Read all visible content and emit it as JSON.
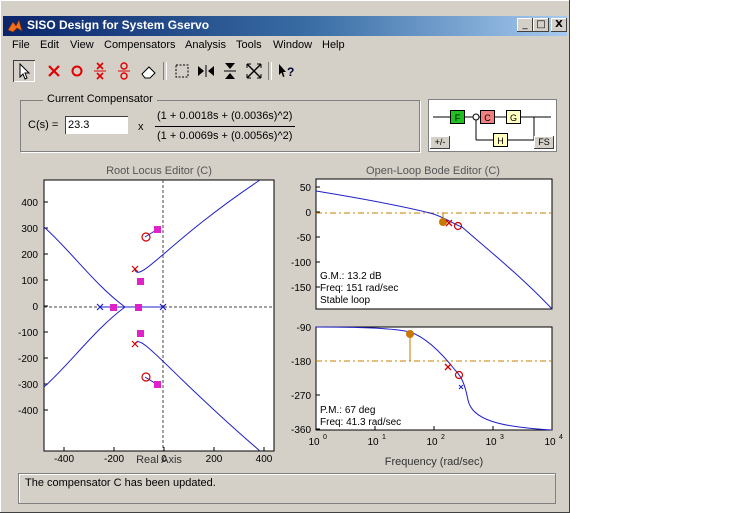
{
  "window": {
    "title": "SISO Design for System Gservo",
    "controls": {
      "minimize": "_",
      "maximize": "□",
      "close": "X"
    }
  },
  "menu": [
    "File",
    "Edit",
    "View",
    "Compensators",
    "Analysis",
    "Tools",
    "Window",
    "Help"
  ],
  "toolbar": {
    "icons": [
      "arrow-select-icon",
      "add-real-pole-icon",
      "add-real-zero-icon",
      "add-complex-pole-icon",
      "add-complex-zero-icon",
      "eraser-icon",
      "zoom-box-icon",
      "zoom-x-icon",
      "zoom-y-icon",
      "zoom-fit-icon",
      "context-help-icon"
    ]
  },
  "compensator": {
    "group_label": "Current Compensator",
    "c_label": "C(s) =",
    "gain": "23.3",
    "times": "x",
    "numerator": "(1 + 0.0018s + (0.0036s)^2)",
    "denominator": "(1 + 0.0069s + (0.0056s)^2)"
  },
  "architecture": {
    "blocks": {
      "f": "F",
      "c": "C",
      "g": "G",
      "h": "H"
    },
    "sign_button": "+/-",
    "fs_button": "FS"
  },
  "root_locus": {
    "title": "Root Locus Editor (C)",
    "xlabel": "Real Axis",
    "yticks": [
      "400",
      "300",
      "200",
      "100",
      "0",
      "-100",
      "-200",
      "-300",
      "-400"
    ],
    "xticks": [
      "-400",
      "-200",
      "0",
      "200",
      "400"
    ]
  },
  "bode": {
    "title": "Open-Loop Bode Editor (C)",
    "xlabel": "Frequency (rad/sec)",
    "mag_yticks": [
      "50",
      "0",
      "-50",
      "-100",
      "-150"
    ],
    "phase_yticks": [
      "-90",
      "-180",
      "-270",
      "-360"
    ],
    "xtick_base": [
      "10",
      "10",
      "10",
      "10",
      "10"
    ],
    "xtick_exp": [
      "0",
      "1",
      "2",
      "3",
      "4"
    ],
    "gm_lines": [
      "G.M.: 13.2 dB",
      "Freq: 151 rad/sec",
      "Stable loop"
    ],
    "pm_lines": [
      "P.M.: 67 deg",
      "Freq: 41.3 rad/sec"
    ]
  },
  "status": "The compensator C has been updated.",
  "colors": {
    "curve": "#1f1fc8",
    "marker_pink": "#e020c8",
    "pole_red": "#d00000",
    "margin_orange": "#c87800",
    "axis_dash": "#c88000"
  }
}
